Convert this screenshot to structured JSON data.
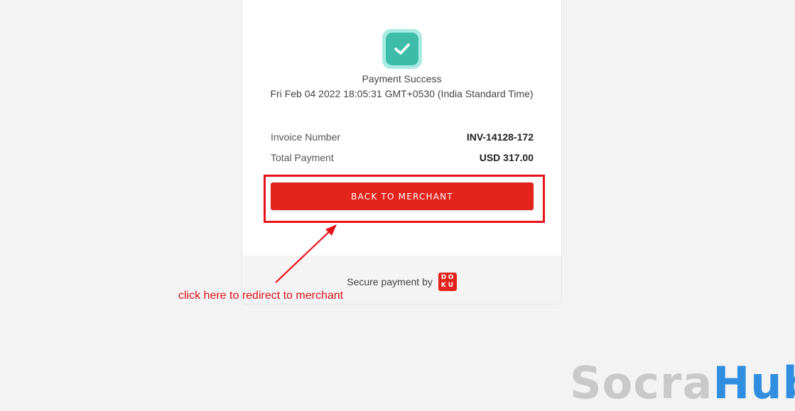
{
  "payment": {
    "status_title": "Payment Success",
    "date": "Fri Feb 04 2022 18:05:31 GMT+0530 (India Standard Time)",
    "invoice_label": "Invoice Number",
    "invoice_value": "INV-14128-172",
    "total_label": "Total Payment",
    "total_value": "USD 317.00",
    "back_button": "BACK TO MERCHANT"
  },
  "footer": {
    "secure_text": "Secure payment by",
    "logo_letters": [
      "D",
      "O",
      "K",
      "U"
    ]
  },
  "annotation": {
    "text": "click here to redirect to merchant"
  },
  "watermark": {
    "part1": "Socra",
    "part2": "Hub"
  },
  "colors": {
    "accent": "#e3241d",
    "success": "#3dbcaa",
    "success_light": "#a9ebe3",
    "annotation": "#d8121a",
    "watermark_blue": "#2f8ee0",
    "watermark_gray": "#c9c9c9"
  },
  "icons": {
    "status": "check-icon",
    "arrow": "arrow-icon"
  }
}
